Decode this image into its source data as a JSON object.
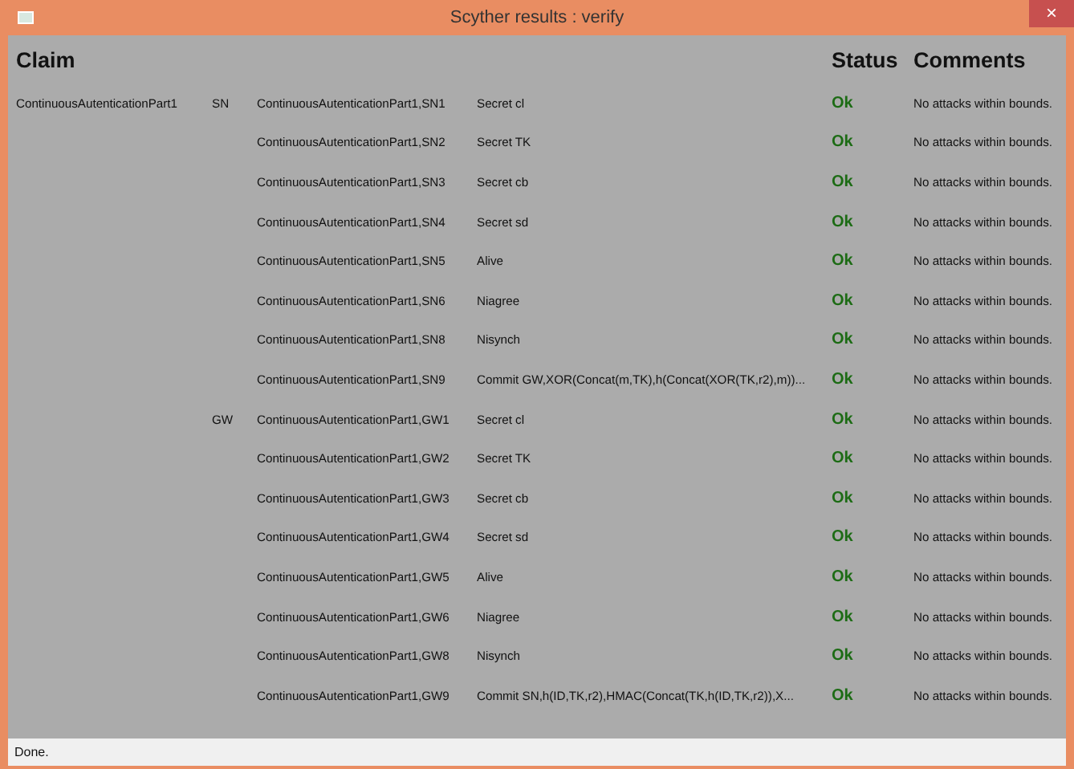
{
  "window": {
    "title": "Scyther results : verify",
    "close": "×"
  },
  "table": {
    "columns": [
      "Claim",
      "Status",
      "Comments"
    ],
    "rows": [
      {
        "protocol": "ContinuousAutenticationPart1",
        "role": "SN",
        "claim_id": "ContinuousAutenticationPart1,SN1",
        "claim": "Secret cl",
        "status": "Ok",
        "comment": "No attacks within bounds."
      },
      {
        "claim_id": "ContinuousAutenticationPart1,SN2",
        "claim": "Secret TK",
        "status": "Ok",
        "comment": "No attacks within bounds."
      },
      {
        "claim_id": "ContinuousAutenticationPart1,SN3",
        "claim": "Secret cb",
        "status": "Ok",
        "comment": "No attacks within bounds."
      },
      {
        "claim_id": "ContinuousAutenticationPart1,SN4",
        "claim": "Secret sd",
        "status": "Ok",
        "comment": "No attacks within bounds."
      },
      {
        "claim_id": "ContinuousAutenticationPart1,SN5",
        "claim": "Alive",
        "status": "Ok",
        "comment": "No attacks within bounds."
      },
      {
        "claim_id": "ContinuousAutenticationPart1,SN6",
        "claim": "Niagree",
        "status": "Ok",
        "comment": "No attacks within bounds."
      },
      {
        "claim_id": "ContinuousAutenticationPart1,SN8",
        "claim": "Nisynch",
        "status": "Ok",
        "comment": "No attacks within bounds."
      },
      {
        "claim_id": "ContinuousAutenticationPart1,SN9",
        "claim": "Commit GW,XOR(Concat(m,TK),h(Concat(XOR(TK,r2),m))...",
        "status": "Ok",
        "comment": "No attacks within bounds."
      },
      {
        "role": "GW",
        "claim_id": "ContinuousAutenticationPart1,GW1",
        "claim": "Secret cl",
        "status": "Ok",
        "comment": "No attacks within bounds."
      },
      {
        "claim_id": "ContinuousAutenticationPart1,GW2",
        "claim": "Secret TK",
        "status": "Ok",
        "comment": "No attacks within bounds."
      },
      {
        "claim_id": "ContinuousAutenticationPart1,GW3",
        "claim": "Secret cb",
        "status": "Ok",
        "comment": "No attacks within bounds."
      },
      {
        "claim_id": "ContinuousAutenticationPart1,GW4",
        "claim": "Secret sd",
        "status": "Ok",
        "comment": "No attacks within bounds."
      },
      {
        "claim_id": "ContinuousAutenticationPart1,GW5",
        "claim": "Alive",
        "status": "Ok",
        "comment": "No attacks within bounds."
      },
      {
        "claim_id": "ContinuousAutenticationPart1,GW6",
        "claim": "Niagree",
        "status": "Ok",
        "comment": "No attacks within bounds."
      },
      {
        "claim_id": "ContinuousAutenticationPart1,GW8",
        "claim": "Nisynch",
        "status": "Ok",
        "comment": "No attacks within bounds."
      },
      {
        "claim_id": "ContinuousAutenticationPart1,GW9",
        "claim": "Commit SN,h(ID,TK,r2),HMAC(Concat(TK,h(ID,TK,r2)),X...",
        "status": "Ok",
        "comment": "No attacks within bounds."
      }
    ]
  },
  "status_bar": "Done."
}
